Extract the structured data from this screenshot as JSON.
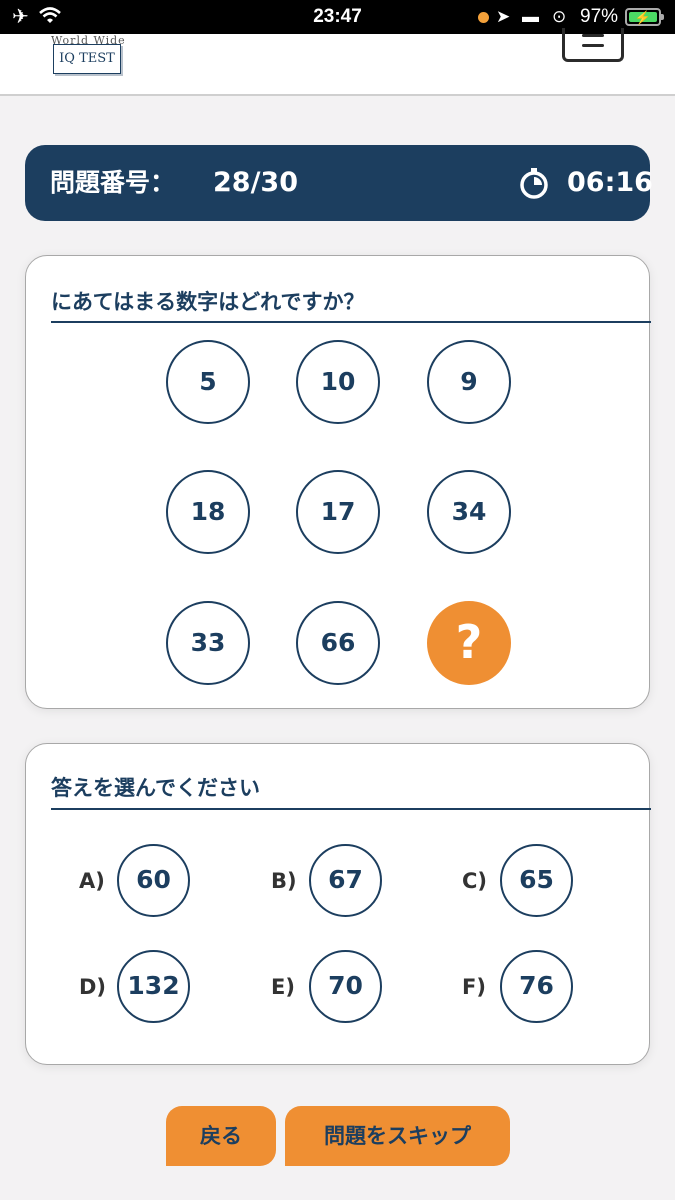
{
  "status_bar": {
    "time": "23:47",
    "battery_percent": "97%"
  },
  "header": {
    "logo_top": "World Wide",
    "logo_main": "IQ TEST"
  },
  "question_bar": {
    "label": "問題番号：",
    "count": "28/30",
    "timer": "06:16"
  },
  "puzzle": {
    "prompt": "にあてはまる数字はどれですか？",
    "cells": [
      "5",
      "10",
      "9",
      "18",
      "17",
      "34",
      "33",
      "66",
      "?"
    ]
  },
  "answers": {
    "title": "答えを選んでください",
    "options": [
      {
        "letter": "A)",
        "value": "60"
      },
      {
        "letter": "B)",
        "value": "67"
      },
      {
        "letter": "C)",
        "value": "65"
      },
      {
        "letter": "D)",
        "value": "132"
      },
      {
        "letter": "E)",
        "value": "70"
      },
      {
        "letter": "F)",
        "value": "76"
      }
    ]
  },
  "buttons": {
    "back": "戻る",
    "skip": "問題をスキップ"
  },
  "colors": {
    "navy": "#1c3e5f",
    "orange": "#ef8f33",
    "background": "#f3f2f3"
  }
}
